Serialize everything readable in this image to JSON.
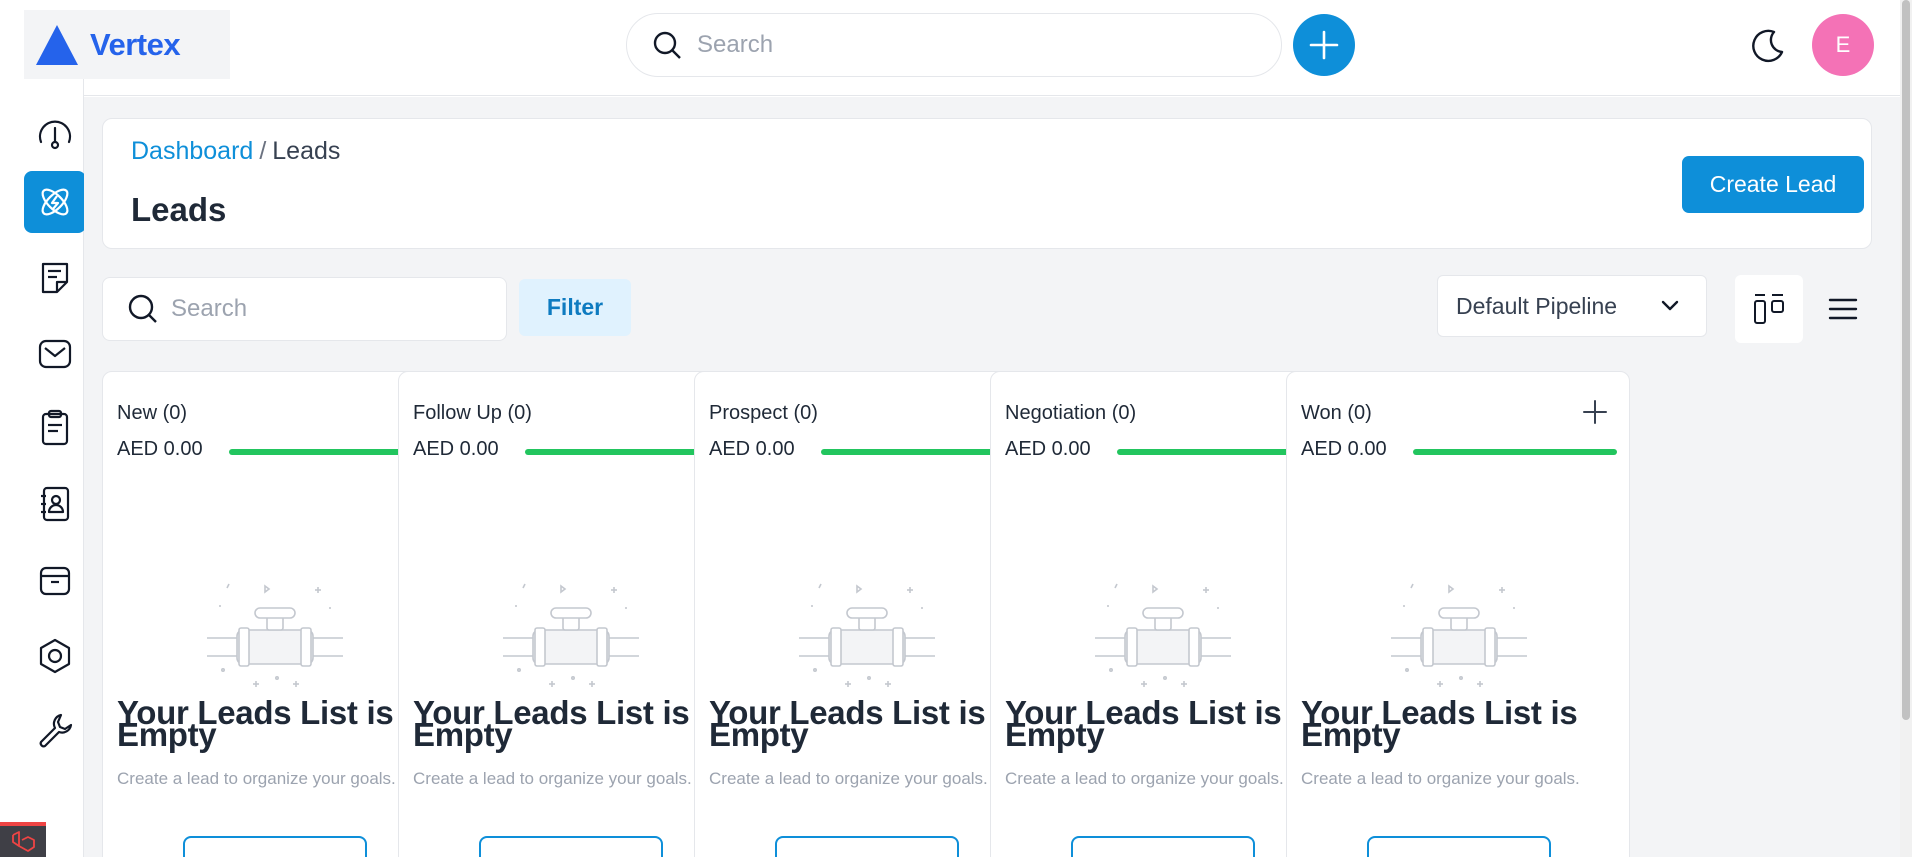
{
  "brand": {
    "name": "Vertex",
    "color": "#2563eb"
  },
  "topbar": {
    "search_placeholder": "Search",
    "avatar_initial": "E",
    "avatar_color": "#f472b6",
    "accent": "#0e8fd9"
  },
  "sidebar": {
    "items": [
      {
        "icon": "dashboard-gauge-icon",
        "active": false
      },
      {
        "icon": "leads-atom-icon",
        "active": true
      },
      {
        "icon": "quotes-note-icon",
        "active": false
      },
      {
        "icon": "mail-icon",
        "active": false
      },
      {
        "icon": "activities-clipboard-icon",
        "active": false
      },
      {
        "icon": "contacts-book-icon",
        "active": false
      },
      {
        "icon": "products-box-icon",
        "active": false
      },
      {
        "icon": "settings-hexagon-icon",
        "active": false
      },
      {
        "icon": "configuration-wrench-icon",
        "active": false
      }
    ]
  },
  "header": {
    "breadcrumb": {
      "link": "Dashboard",
      "separator": "/",
      "current": "Leads"
    },
    "title": "Leads",
    "create_label": "Create Lead"
  },
  "toolbar": {
    "search_placeholder": "Search",
    "filter_label": "Filter",
    "pipeline_selected": "Default Pipeline"
  },
  "columns": [
    {
      "title": "New (0)",
      "amount": "AED 0.00",
      "empty_title": "Your Leads List is Empty",
      "empty_desc": "Create a lead to organize your goals."
    },
    {
      "title": "Follow Up (0)",
      "amount": "AED 0.00",
      "empty_title": "Your Leads List is Empty",
      "empty_desc": "Create a lead to organize your goals."
    },
    {
      "title": "Prospect (0)",
      "amount": "AED 0.00",
      "empty_title": "Your Leads List is Empty",
      "empty_desc": "Create a lead to organize your goals."
    },
    {
      "title": "Negotiation (0)",
      "amount": "AED 0.00",
      "empty_title": "Your Leads List is Empty",
      "empty_desc": "Create a lead to organize your goals."
    },
    {
      "title": "Won (0)",
      "amount": "AED 0.00",
      "empty_title": "Your Leads List is Empty",
      "empty_desc": "Create a lead to organize your goals."
    }
  ],
  "status_colors": {
    "progress": "#22c55e"
  }
}
